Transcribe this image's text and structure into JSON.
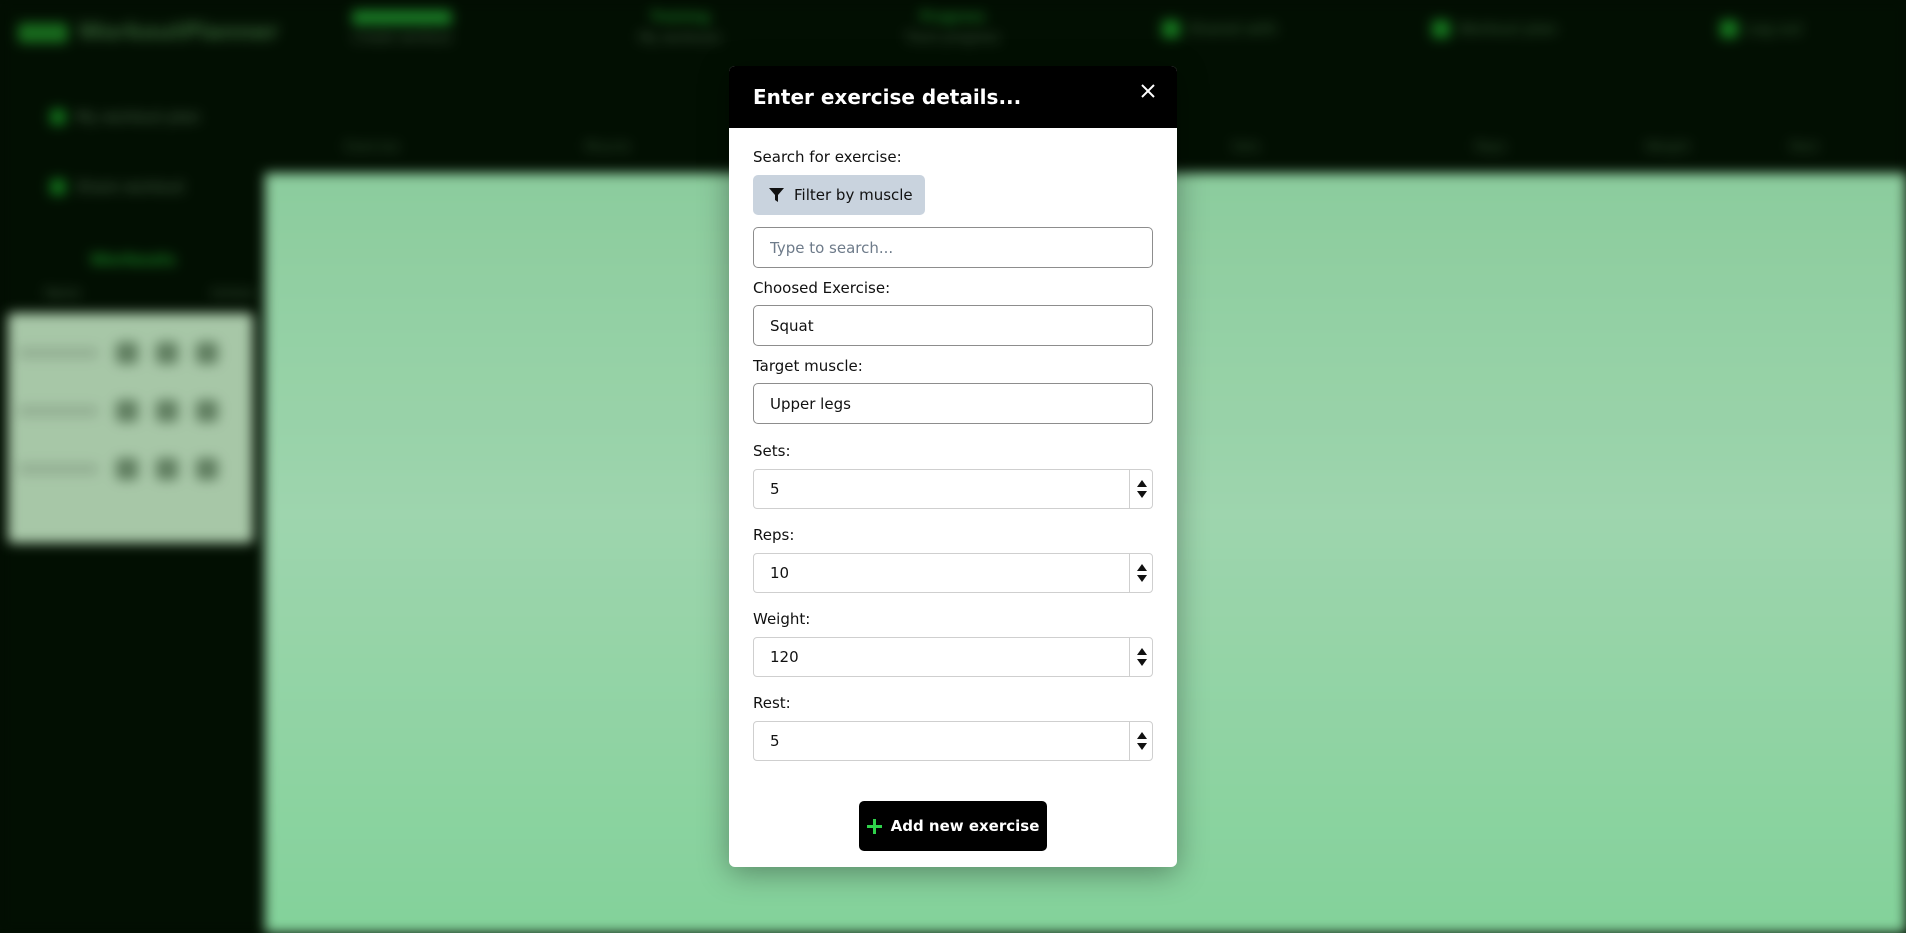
{
  "background": {
    "brand": "WorkoutPlanner",
    "nav": [
      {
        "line1": "Exercise list",
        "line2": "Create workout"
      },
      {
        "line1": "Training",
        "line2": "My workouts"
      },
      {
        "line1": "Progress",
        "line2": "Track progress"
      }
    ],
    "top_right": [
      "Shared with",
      "Workout plan",
      "Log out"
    ],
    "sidebar_items": [
      "My workout plan",
      "Share workout"
    ],
    "sidebar_title": "Workouts",
    "sidebar_cols": [
      "Name",
      "Actions"
    ],
    "table_cols": [
      "Exercise",
      "Muscle",
      "Sets",
      "Reps",
      "Weight",
      "Rest",
      "Actions"
    ]
  },
  "modal": {
    "title": "Enter exercise details...",
    "search_label": "Search for exercise:",
    "filter_button": "Filter by muscle",
    "search_placeholder": "Type to search...",
    "chosen_label": "Choosed Exercise:",
    "chosen_value": "Squat",
    "target_label": "Target muscle:",
    "target_value": "Upper legs",
    "sets_label": "Sets:",
    "sets_value": "5",
    "reps_label": "Reps:",
    "reps_value": "10",
    "weight_label": "Weight:",
    "weight_value": "120",
    "rest_label": "Rest:",
    "rest_value": "5",
    "add_button": "Add new exercise"
  },
  "colors": {
    "accent": "#2fd14a",
    "modal_header": "#000000",
    "filter_button_bg": "#c9d3de",
    "page_bg_green": "#a7f2bd"
  }
}
